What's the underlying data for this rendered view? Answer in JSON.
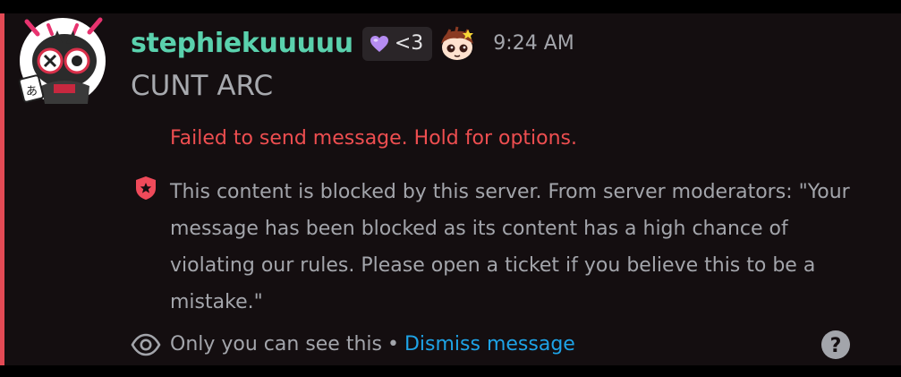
{
  "message": {
    "username": "stephiekuuuuu",
    "role_tag": {
      "text": "<3",
      "icon": "purple-heart-icon"
    },
    "decoration_emoji": "anime-character-emoji",
    "timestamp": "9:24 AM",
    "content": "CUNT ARC"
  },
  "error": {
    "text": "Failed to send message. Hold for options."
  },
  "blocked_notice": {
    "icon": "shield-star-icon",
    "text": "This content is blocked by this server. From server moderators: \"Your message has been blocked as its content has a high chance of violating our rules. Please open a ticket if you believe this to be a mistake.\""
  },
  "ephemeral": {
    "icon": "eye-icon",
    "text": "Only you can see this",
    "separator": "•",
    "dismiss_label": "Dismiss message",
    "help_icon": "question-mark-icon"
  },
  "colors": {
    "background": "#140e10",
    "accent_bar": "#e34a55",
    "username": "#5ad1ad",
    "error": "#ee4e50",
    "link": "#1ea3e6",
    "muted_text": "#a3a5ab"
  }
}
